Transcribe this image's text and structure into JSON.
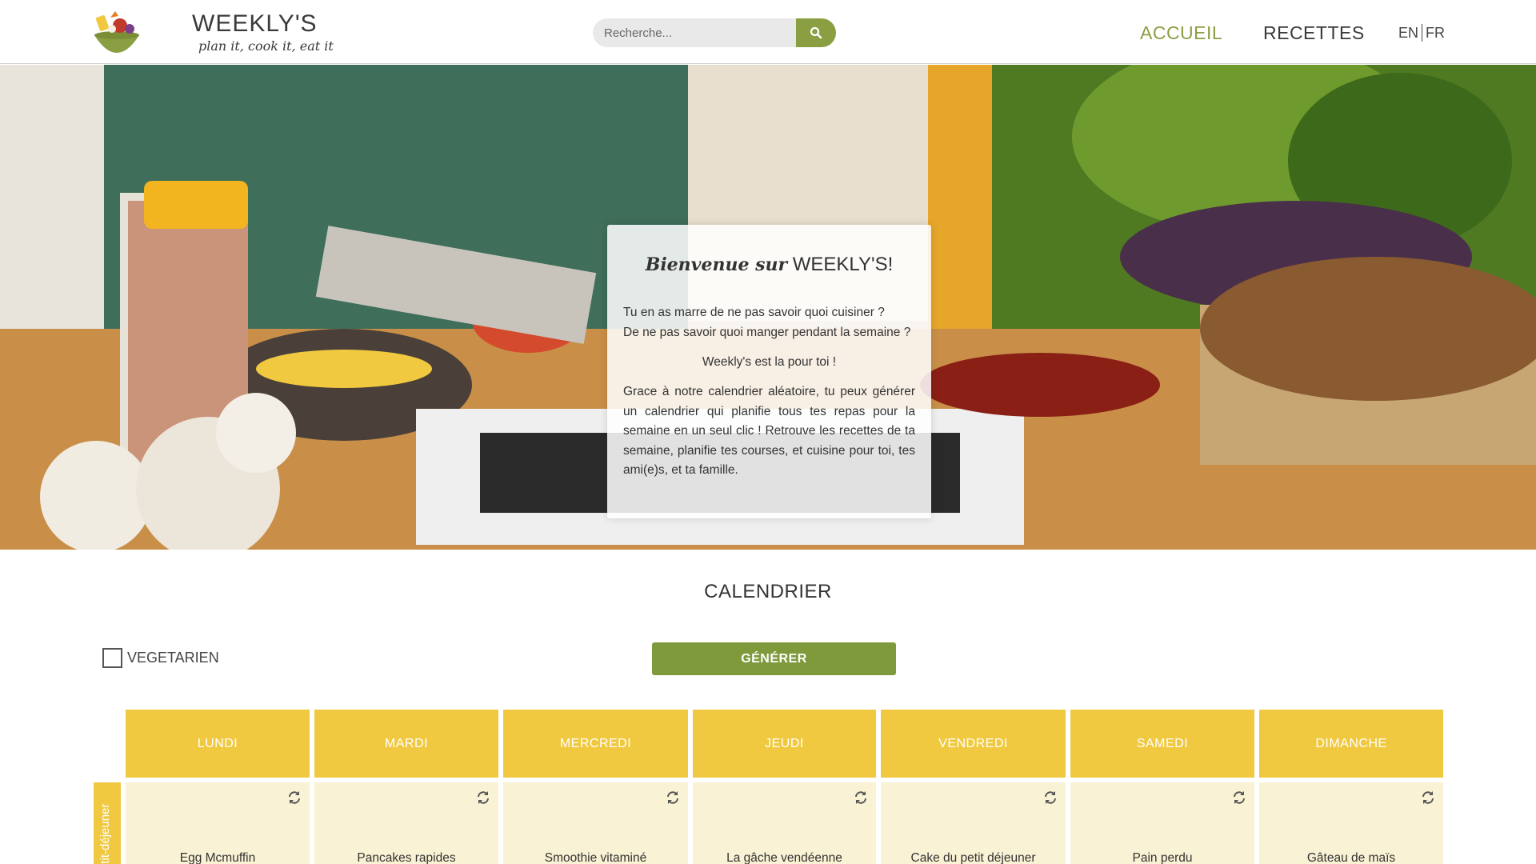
{
  "header": {
    "brand_name": "WEEKLY'S",
    "brand_tagline": "plan it, cook it, eat it",
    "search_placeholder": "Recherche...",
    "nav": [
      "ACCUEIL",
      "RECETTES"
    ],
    "lang_en": "EN",
    "lang_fr": "FR"
  },
  "welcome": {
    "title_script": "Bienvenue sur",
    "title_brand": "WEEKLY'S!",
    "line1": "Tu en as marre de ne pas savoir quoi cuisiner ?",
    "line2": "De ne pas savoir quoi manger pendant la semaine ?",
    "tagline": "Weekly's est la pour toi !",
    "paragraph": "Grace à notre calendrier aléatoire, tu peux générer un calendrier qui planifie tous tes repas pour la semaine en un seul clic ! Retrouve les recettes de ta semaine, planifie tes courses, et cuisine pour toi, tes ami(e)s, et ta famille."
  },
  "calendar": {
    "title": "CALENDRIER",
    "vegetarian_label": "VEGETARIEN",
    "generate_label": "GÉNÉRER",
    "days": [
      "LUNDI",
      "MARDI",
      "MERCREDI",
      "JEUDI",
      "VENDREDI",
      "SAMEDI",
      "DIMANCHE"
    ],
    "row_label": "Petit-déjeuner",
    "breakfast": [
      "Egg Mcmuffin",
      "Pancakes rapides",
      "Smoothie vitaminé",
      "La gâche vendéenne",
      "Cake du petit déjeuner",
      "Pain perdu",
      "Gâteau de maïs"
    ]
  },
  "colors": {
    "accent_green": "#8a9e42",
    "button_green": "#7e9a3a",
    "day_yellow": "#f0c940",
    "cell_cream": "#faf2d4"
  }
}
